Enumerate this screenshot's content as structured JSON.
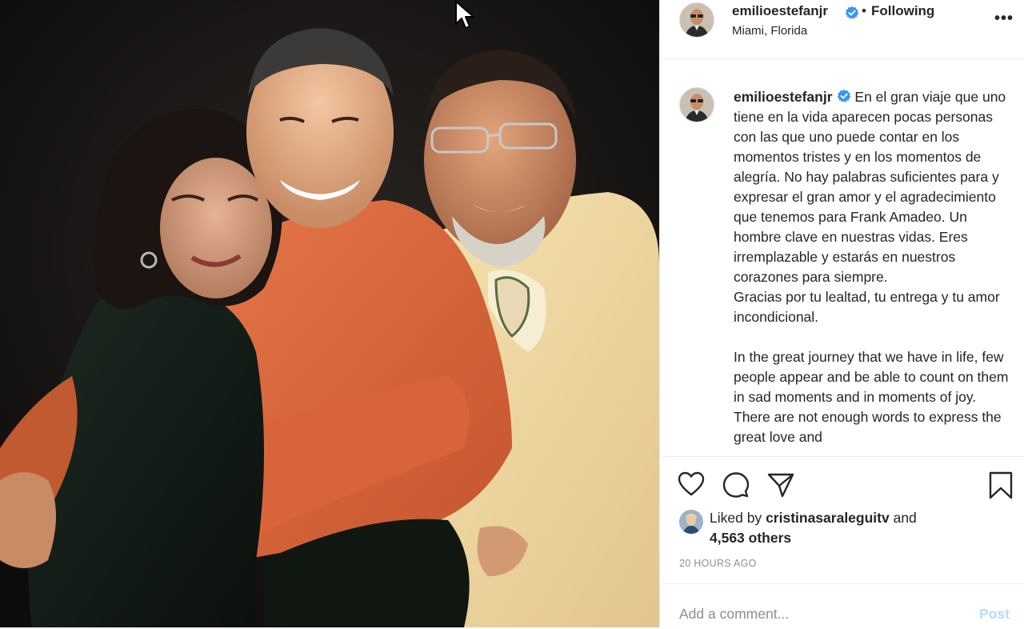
{
  "post": {
    "author": "emilioestefanjr",
    "verified": true,
    "follow_status": "Following",
    "separator": "•",
    "location": "Miami, Florida",
    "more_icon": "more-options-icon"
  },
  "caption": {
    "username": "emilioestefanjr",
    "paragraph_es": "En el gran viaje que uno tiene en la vida aparecen pocas personas con las que uno puede contar en los momentos tristes y en los momentos de alegría. No hay palabras suficientes para y expresar el gran amor y el agradecimiento que tenemos para Frank Amadeo. Un hombre clave en nuestras vidas. Eres irremplazable y estarás en nuestros corazones para siempre.",
    "paragraph_es2": "Gracias por tu lealtad, tu entrega y tu amor incondicional.",
    "paragraph_en": "In the great journey that we have in life, few people appear and be able to count on them in sad moments and in moments of joy. There are not enough words to express the great love and"
  },
  "actions": {
    "like_icon": "heart-icon",
    "comment_icon": "comment-icon",
    "share_icon": "share-icon",
    "save_icon": "bookmark-icon"
  },
  "likes": {
    "prefix": "Liked by",
    "user": "cristinasaraleguitv",
    "joiner": "and",
    "others": "4,563 others"
  },
  "timestamp": "20 HOURS AGO",
  "comment": {
    "placeholder": "Add a comment...",
    "post_label": "Post"
  },
  "colors": {
    "verified_blue": "#3897f0",
    "post_disabled": "#b2dffc",
    "text": "#262626",
    "muted": "#8e8e8e"
  }
}
